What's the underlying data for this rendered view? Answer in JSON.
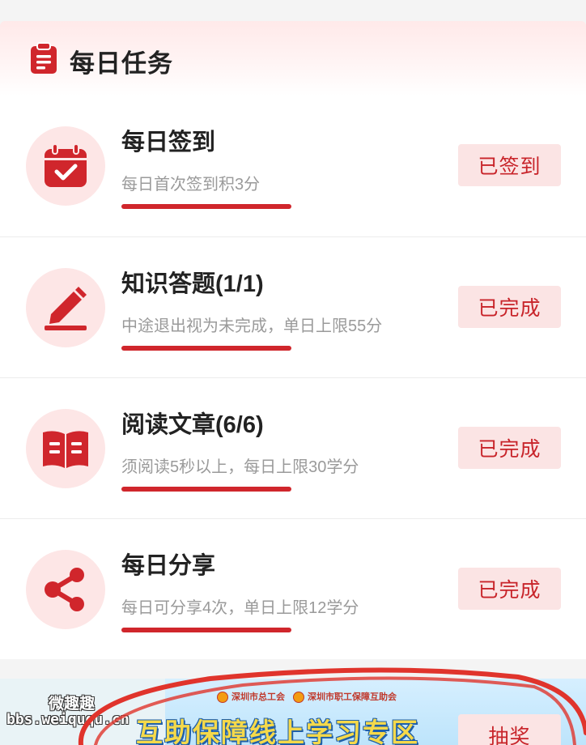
{
  "header": {
    "title": "每日任务",
    "icon": "clipboard-icon"
  },
  "tasks": [
    {
      "title": "每日签到",
      "desc": "每日首次签到积3分",
      "button": "已签到",
      "icon": "calendar-check-icon"
    },
    {
      "title": "知识答题(1/1)",
      "desc": "中途退出视为未完成，单日上限55分",
      "button": "已完成",
      "icon": "pen-icon"
    },
    {
      "title": "阅读文章(6/6)",
      "desc": "须阅读5秒以上，每日上限30学分",
      "button": "已完成",
      "icon": "book-icon"
    },
    {
      "title": "每日分享",
      "desc": "每日可分享4次，单日上限12学分",
      "button": "已完成",
      "icon": "share-icon"
    }
  ],
  "banner": {
    "watermark_line1": "微趣趣",
    "watermark_line2": "bbs.weiququ.cn",
    "org1": "深圳市总工会",
    "org2": "深圳市职工保障互助会",
    "headline": "互助保障线上学习专区",
    "button": "抽奖"
  },
  "colors": {
    "accent": "#d0262c",
    "button_bg": "#fbe4e4",
    "icon_circle_bg": "#fde6e6"
  }
}
